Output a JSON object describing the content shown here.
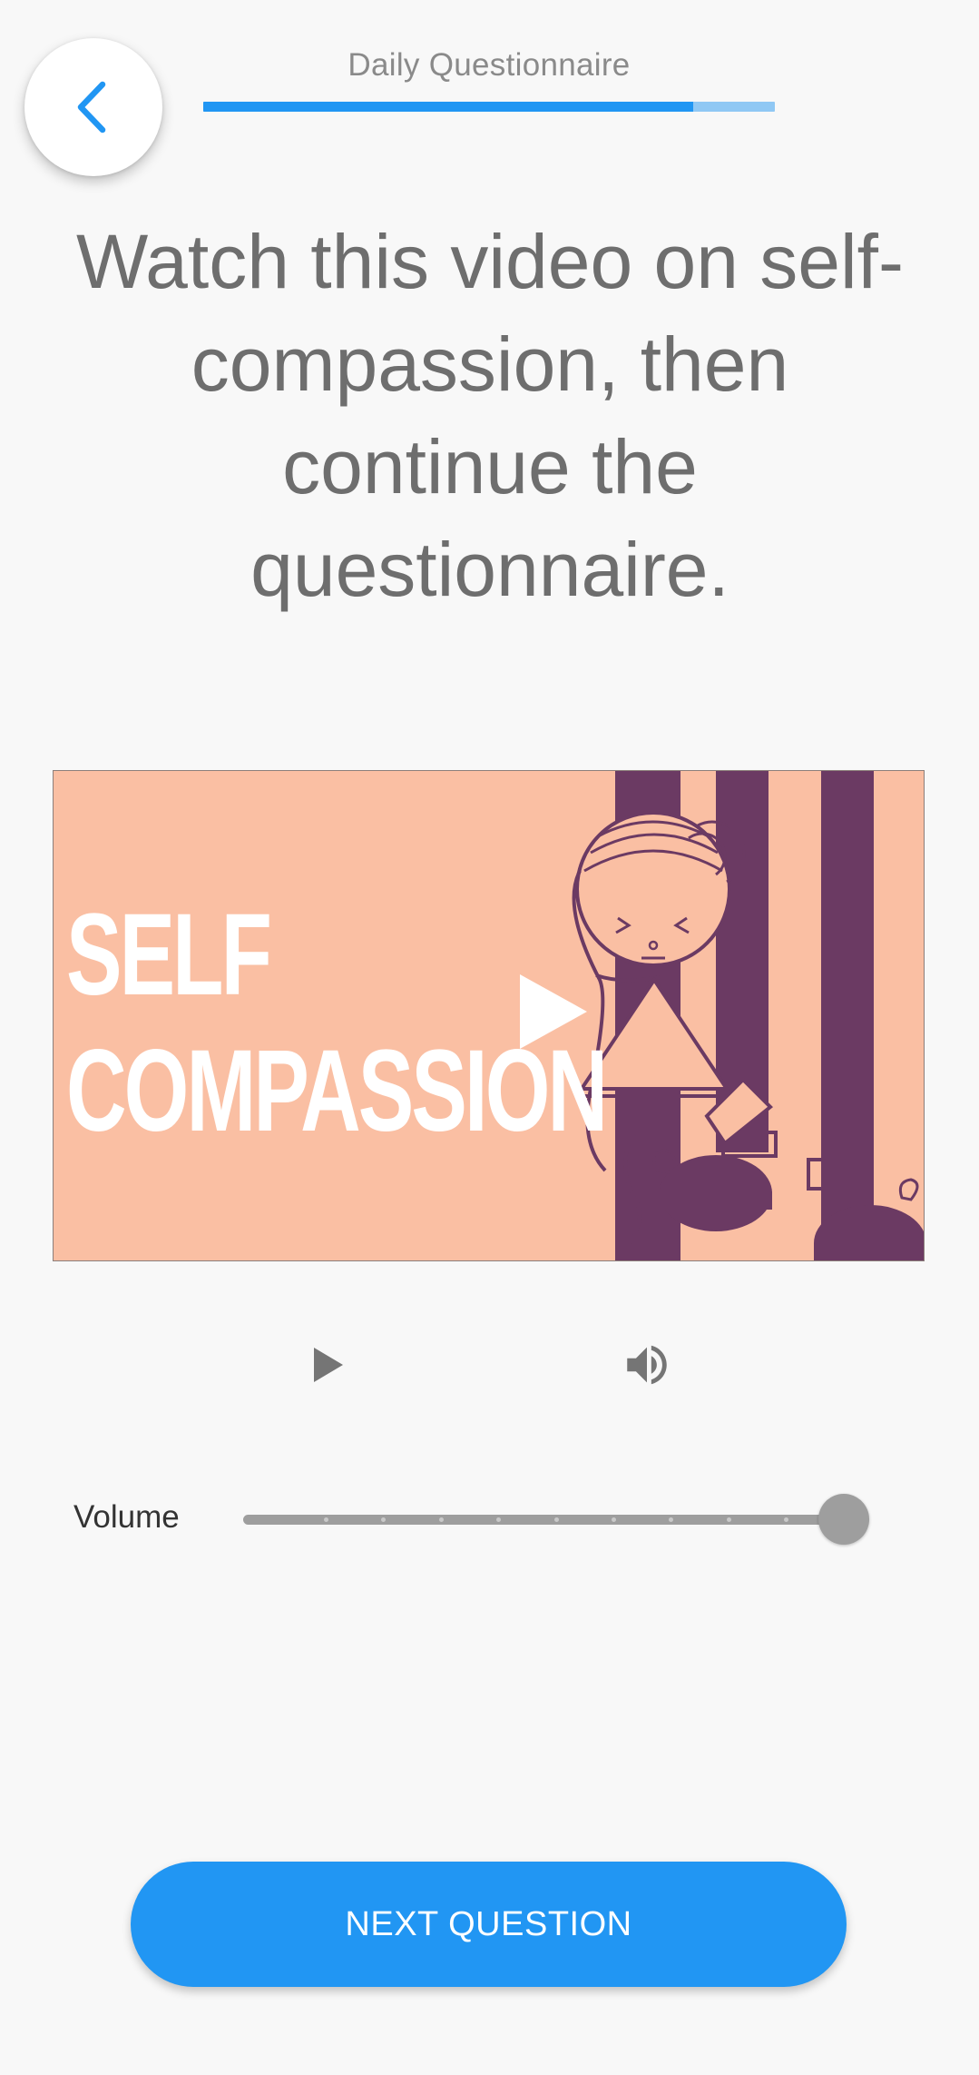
{
  "header": {
    "title": "Daily Questionnaire",
    "progress": 0.857,
    "back_icon": "chevron-left-icon"
  },
  "main": {
    "heading": "Watch this video on self-compassion, then continue the questionnaire."
  },
  "video": {
    "thumbnail_text": "SELF\nCOMPASSION",
    "play_icon": "play-icon"
  },
  "player_controls": {
    "play_icon": "play-icon",
    "volume_icon": "volume-up-icon"
  },
  "volume": {
    "label": "Volume",
    "value": 1.0,
    "steps": 10
  },
  "footer": {
    "next_label": "NEXT QUESTION"
  },
  "colors": {
    "accent": "#2196f3",
    "accent_light": "#90c8f4",
    "background": "#f8f8f8",
    "video_background": "#fabfa3",
    "video_purple": "#6b3a63"
  }
}
